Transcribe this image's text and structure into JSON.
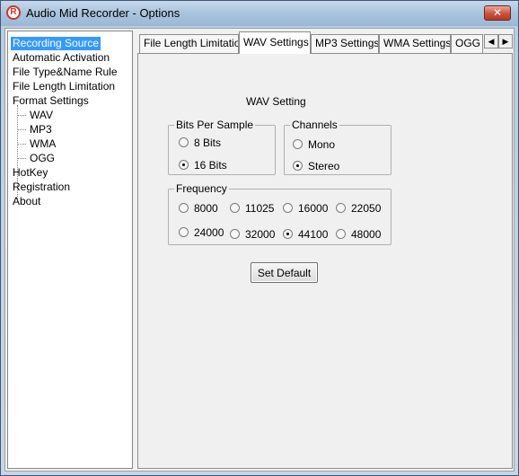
{
  "window": {
    "title": "Audio Mid Recorder - Options",
    "close_label": "✕",
    "icon_letter": "R"
  },
  "tree": {
    "items": [
      {
        "label": "Recording Source",
        "selected": true
      },
      {
        "label": "Automatic Activation"
      },
      {
        "label": "File Type&Name Rule"
      },
      {
        "label": "File Length Limitation"
      },
      {
        "label": "Format Settings"
      },
      {
        "label": "WAV"
      },
      {
        "label": "MP3"
      },
      {
        "label": "WMA"
      },
      {
        "label": "OGG"
      },
      {
        "label": "HotKey"
      },
      {
        "label": "Registration"
      },
      {
        "label": "About"
      }
    ]
  },
  "tabs": [
    {
      "label": "File Length Limitation"
    },
    {
      "label": "WAV Settings",
      "active": true
    },
    {
      "label": "MP3 Settings"
    },
    {
      "label": "WMA Settings"
    },
    {
      "label": "OGG S"
    }
  ],
  "tab_scroll": {
    "left": "◀",
    "right": "▶"
  },
  "wav": {
    "heading": "WAV Setting",
    "bits_group": {
      "label": "Bits Per Sample",
      "options": [
        "8 Bits",
        "16 Bits"
      ],
      "selected": "16 Bits"
    },
    "channels_group": {
      "label": "Channels",
      "options": [
        "Mono",
        "Stereo"
      ],
      "selected": "Stereo"
    },
    "frequency_group": {
      "label": "Frequency",
      "options": [
        "8000",
        "11025",
        "16000",
        "22050",
        "24000",
        "32000",
        "44100",
        "48000"
      ],
      "selected": "44100"
    },
    "set_default_label": "Set Default"
  }
}
